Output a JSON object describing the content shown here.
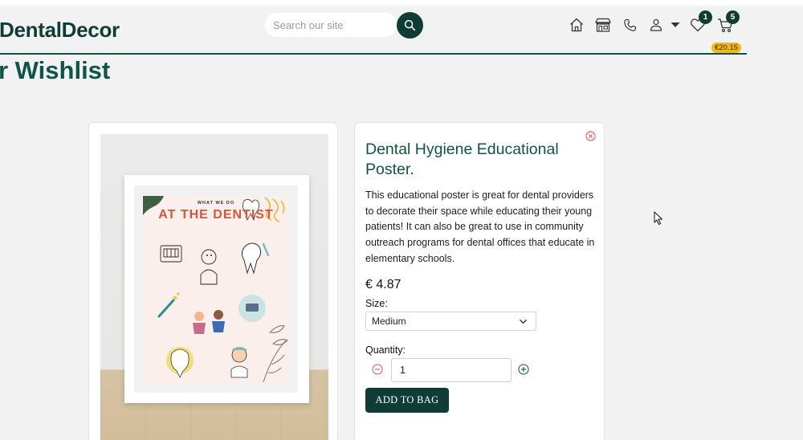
{
  "brand": {
    "name": "DentalDecor"
  },
  "search": {
    "placeholder": "Search our site"
  },
  "nav": {
    "icons": [
      "home-icon",
      "store-icon",
      "phone-icon",
      "user-icon",
      "chevron-down-icon",
      "heart-icon",
      "cart-icon"
    ],
    "wishlist_count": "1",
    "cart_count": "5",
    "cart_total": "€20.15"
  },
  "page": {
    "title": "r Wishlist"
  },
  "product": {
    "title": "Dental Hygiene Educational Poster.",
    "description": "This educational poster is great for dental providers to decorate their space while educating their young patients! It can also be great to use in community outreach programs for dental offices that educate in elementary schools.",
    "price": "€ 4.87",
    "size_label": "Size:",
    "size_value": "Medium",
    "quantity_label": "Quantity:",
    "quantity_value": "1",
    "add_button": "ADD TO BAG"
  },
  "poster_image": {
    "small_text": "WHAT WE DO",
    "big_text": "AT THE DENTIST"
  },
  "colors": {
    "brand_dark": "#0f3d36",
    "brand_green": "#0e5448",
    "badge_yellow": "#f3b71c",
    "close_red": "#d9534f"
  }
}
